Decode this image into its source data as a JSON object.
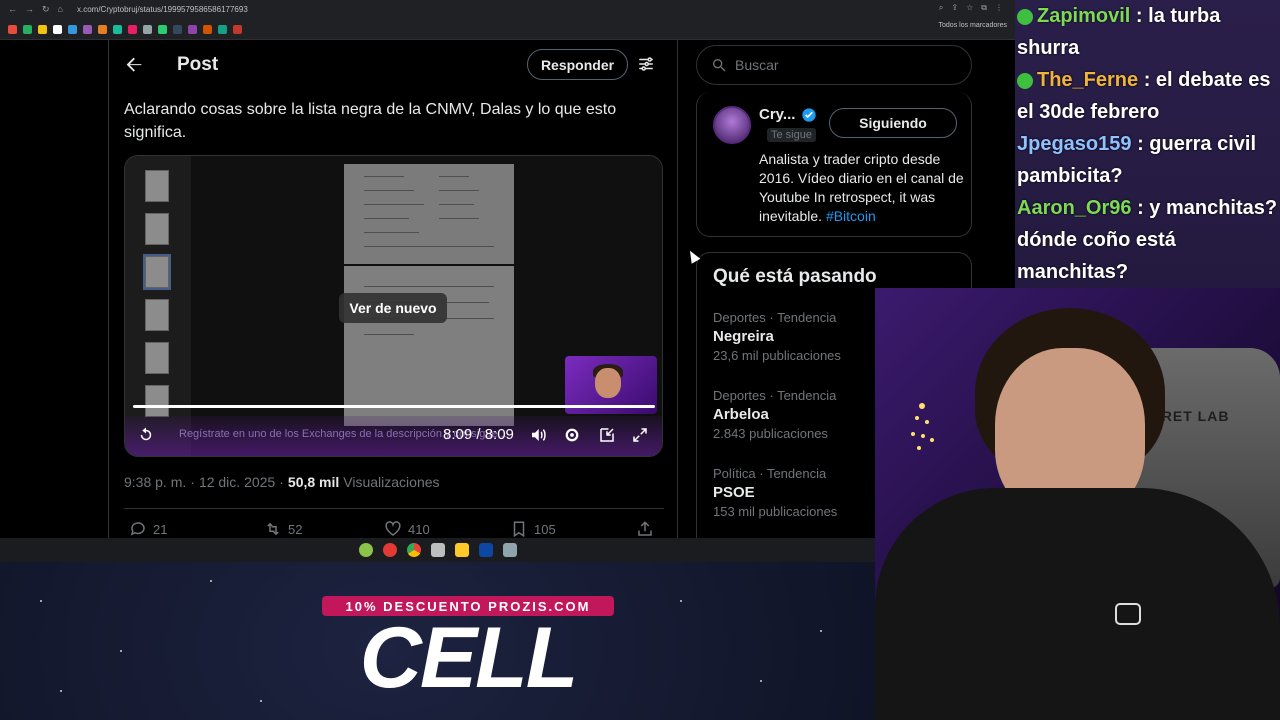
{
  "browser": {
    "url": "x.com/Cryptobruj/status/1999579586586177693",
    "bookmarks_all": "Todos los marcadores"
  },
  "post": {
    "title": "Post",
    "reply_label": "Responder",
    "text": "Aclarando cosas sobre la lista negra de la CNMV, Dalas y lo que esto significa.",
    "video": {
      "replay_label": "Ver de nuevo",
      "time": "8:09 / 8:09",
      "subtitle": "Regístrate en uno de los Exchanges de la descripción y consigue..."
    },
    "meta": {
      "time": "9:38 p. m.",
      "dot1": "·",
      "date": "12 dic. 2025",
      "dot2": "·",
      "views_count": "50,8 mil",
      "views_label": "Visualizaciones"
    },
    "actions": {
      "replies": "21",
      "reposts": "52",
      "likes": "410",
      "bookmarks": "105"
    }
  },
  "sidebar": {
    "search_placeholder": "Buscar",
    "profile": {
      "name": "Cry...",
      "follows_you": "Te sigue",
      "follow_label": "Siguiendo",
      "bio": "Analista y trader cripto desde 2016. Vídeo diario en el canal de Youtube In retrospect, it was inevitable.",
      "hashtag": "#Bitcoin"
    },
    "trends_title": "Qué está pasando",
    "trends": [
      {
        "category": "Deportes · Tendencia",
        "name": "Negreira",
        "count": "23,6 mil publicaciones"
      },
      {
        "category": "Deportes · Tendencia",
        "name": "Arbeloa",
        "count": "2.843 publicaciones"
      },
      {
        "category": "Política · Tendencia",
        "name": "PSOE",
        "count": "153 mil publicaciones"
      }
    ]
  },
  "chat": {
    "messages": [
      {
        "user": "Zapimovil",
        "text": ": la turba shurra",
        "color": "#7ed957"
      },
      {
        "user": "The_Ferne",
        "text": ": el debate es el 30de febrero",
        "color": "#f0b43c"
      },
      {
        "user": "Jpegaso159",
        "text": ": guerra civil pambicita?",
        "color": "#8fc2ff"
      },
      {
        "user": "Aaron_Or96",
        "text": ": y manchitas? dónde coño está manchitas?",
        "color": "#7ed957"
      }
    ]
  },
  "webcam": {
    "chair_logo": "SECRET LAB"
  },
  "promo": {
    "tag": "10% DESCUENTO PROZIS.COM",
    "big": "CELL"
  },
  "colors": {
    "accent": "#1d9bf0",
    "promo": "#c2185b",
    "chat_bg": "#2a1f4a"
  }
}
